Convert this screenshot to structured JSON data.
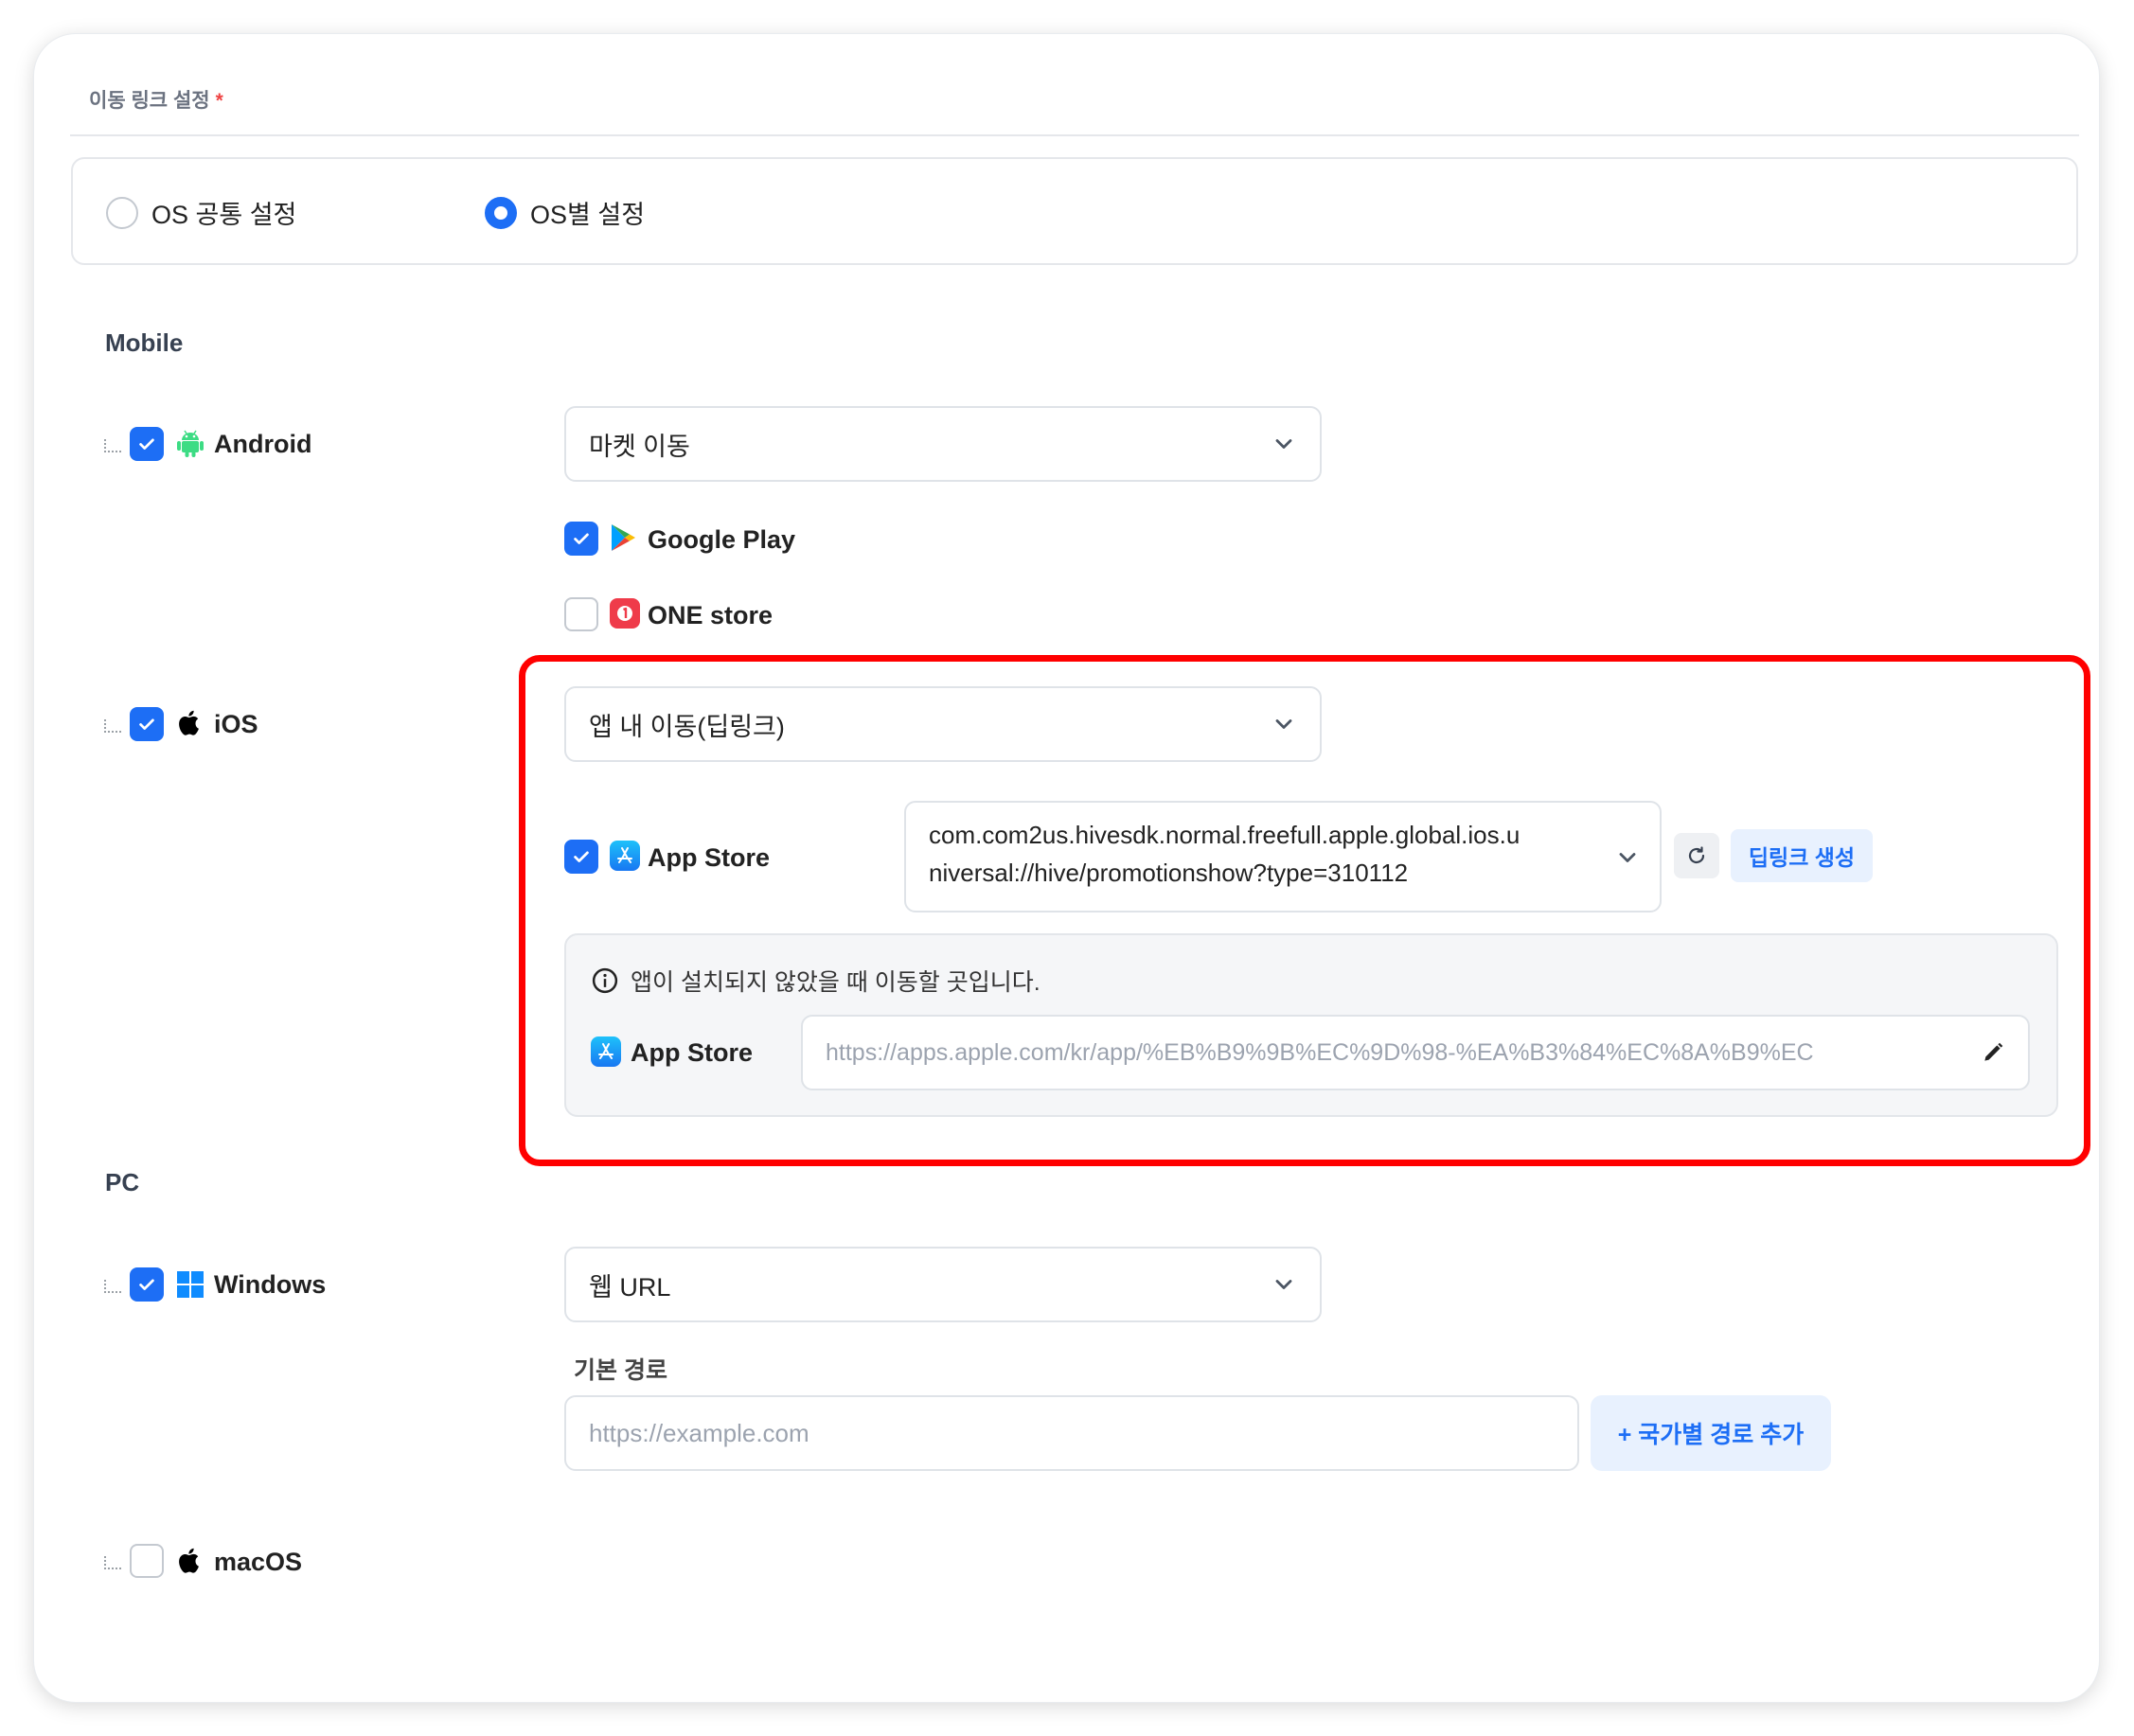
{
  "section": {
    "title": "이동 링크 설정",
    "required_mark": "*"
  },
  "mode": {
    "options": [
      {
        "label": "OS 공통 설정",
        "selected": false
      },
      {
        "label": "OS별 설정",
        "selected": true
      }
    ]
  },
  "mobile": {
    "title": "Mobile",
    "android": {
      "label": "Android",
      "checked": true,
      "action": "마켓 이동",
      "stores": [
        {
          "label": "Google Play",
          "checked": true
        },
        {
          "label": "ONE store",
          "checked": false
        }
      ]
    },
    "ios": {
      "label": "iOS",
      "checked": true,
      "action": "앱 내 이동(딥링크)",
      "app_store": {
        "label": "App Store",
        "checked": true,
        "deeplink": "com.com2us.hivesdk.normal.freefull.apple.global.ios.universal://hive/promotionshow?type=310112",
        "deeplink_line1": "com.com2us.hivesdk.normal.freefull.apple.global.ios.u",
        "deeplink_line2": "niversal://hive/promotionshow?type=310112",
        "generate_button": "딥링크 생성"
      },
      "fallback": {
        "info": "앱이 설치되지 않았을 때 이동할 곳입니다.",
        "store_label": "App Store",
        "url": "https://apps.apple.com/kr/app/%EB%B9%9B%EC%9D%98-%EA%B3%84%EC%8A%B9%EC"
      }
    }
  },
  "pc": {
    "title": "PC",
    "windows": {
      "label": "Windows",
      "checked": true,
      "action": "웹 URL",
      "base_path_label": "기본 경로",
      "base_path_placeholder": "https://example.com",
      "add_country_button": "+ 국가별 경로 추가"
    },
    "macos": {
      "label": "macOS",
      "checked": false
    }
  },
  "colors": {
    "accent": "#1d6ef5",
    "highlight": "#ff0000",
    "required": "#ef4444"
  }
}
